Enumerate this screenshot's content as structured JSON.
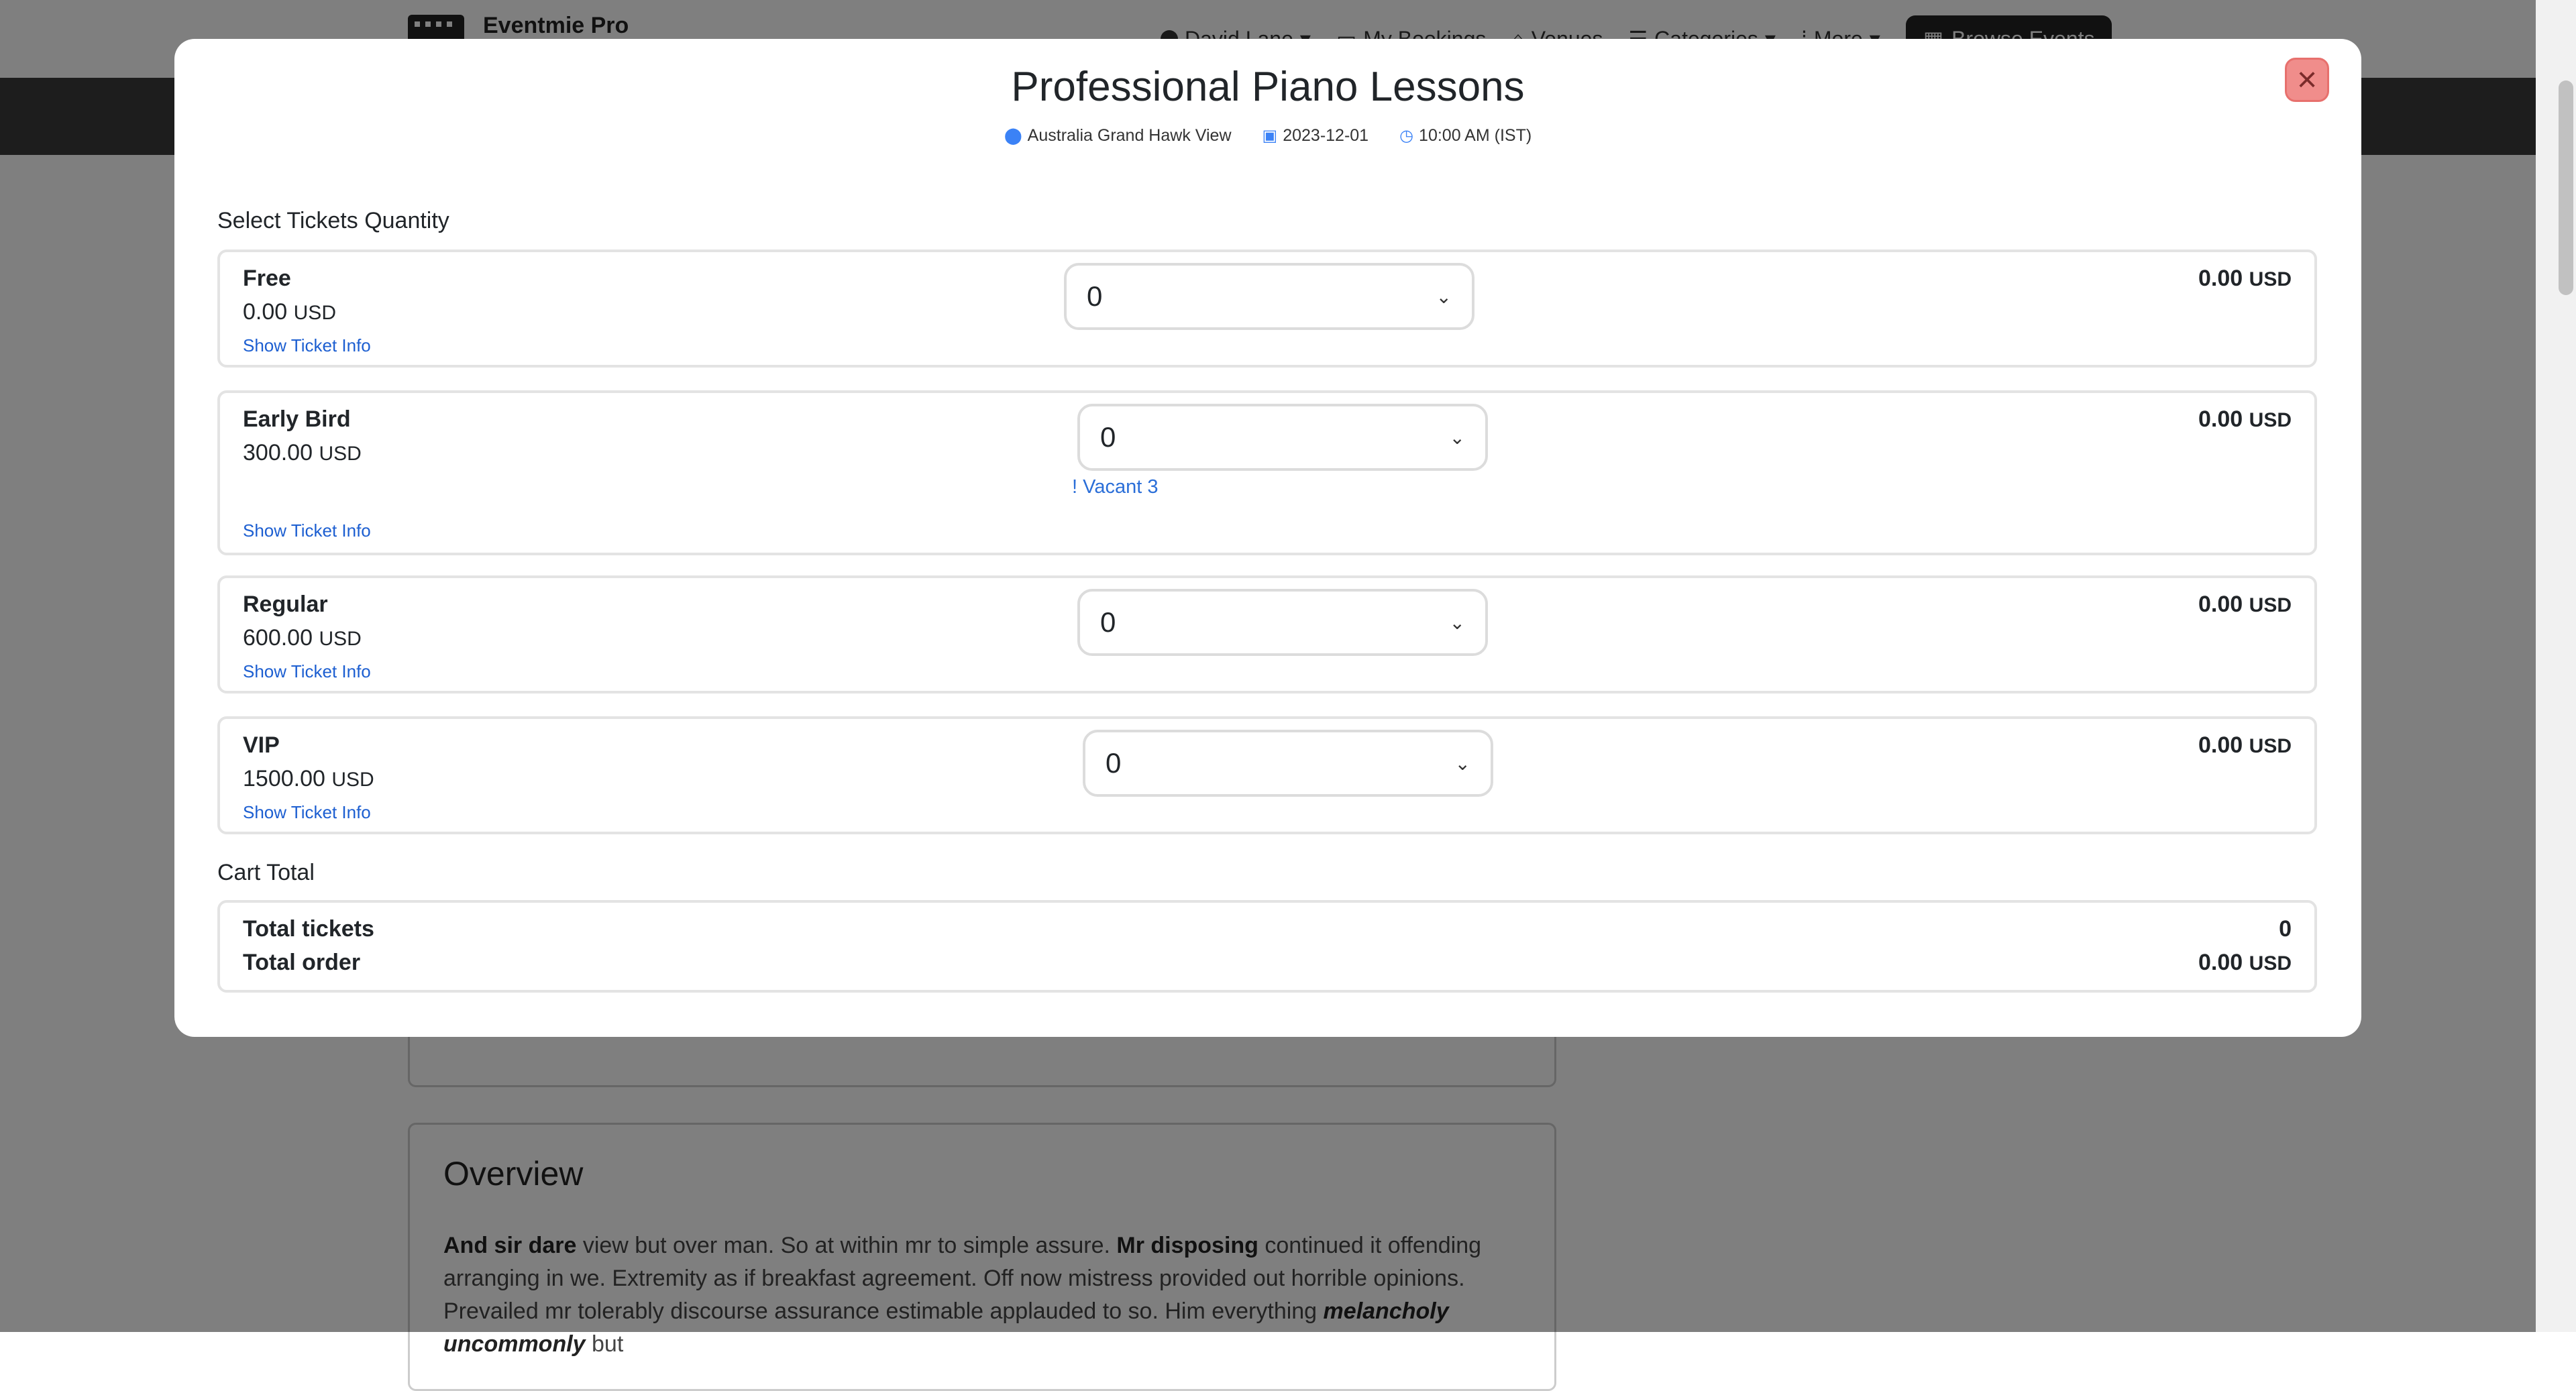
{
  "brand": {
    "name": "Eventmie Pro"
  },
  "nav": {
    "user": "David Lane",
    "bookings": "My Bookings",
    "venues": "Venues",
    "categories": "Categories",
    "more": "More",
    "browse": "Browse Events"
  },
  "overview": {
    "title": "Overview",
    "p1_b1": "And sir dare",
    "p1_t1": " view but over man. So at within mr to simple assure. ",
    "p1_b2": "Mr disposing",
    "p1_t2": " continued it offending arranging in we. Extremity as if breakfast agreement. Off now mistress provided out horrible opinions. Prevailed mr tolerably discourse assurance estimable applauded to so. Him everything ",
    "p1_bi": "melancholy uncommonly",
    "p1_t3": " but"
  },
  "modal": {
    "title": "Professional Piano Lessons",
    "venue": "Australia Grand Hawk View",
    "date": "2023-12-01",
    "time": "10:00 AM (IST)",
    "select_label": "Select Tickets Quantity",
    "cart_label": "Cart Total",
    "close_icon": "close-icon"
  },
  "tickets": [
    {
      "name": "Free",
      "price": "0.00",
      "currency": "USD",
      "info": "Show Ticket Info",
      "qty": "0",
      "total": "0.00"
    },
    {
      "name": "Early Bird",
      "price": "300.00",
      "currency": "USD",
      "info": "Show Ticket Info",
      "qty": "0",
      "total": "0.00",
      "vacant": "Vacant 3"
    },
    {
      "name": "Regular",
      "price": "600.00",
      "currency": "USD",
      "info": "Show Ticket Info",
      "qty": "0",
      "total": "0.00"
    },
    {
      "name": "VIP",
      "price": "1500.00",
      "currency": "USD",
      "info": "Show Ticket Info",
      "qty": "0",
      "total": "0.00"
    }
  ],
  "cart": {
    "tickets_label": "Total tickets",
    "tickets_value": "0",
    "order_label": "Total order",
    "order_value": "0.00",
    "currency": "USD"
  },
  "colors": {
    "accent": "#1d5fd1",
    "close_bg": "#f08d8b",
    "overlay": "rgba(0,0,0,0.5)"
  }
}
